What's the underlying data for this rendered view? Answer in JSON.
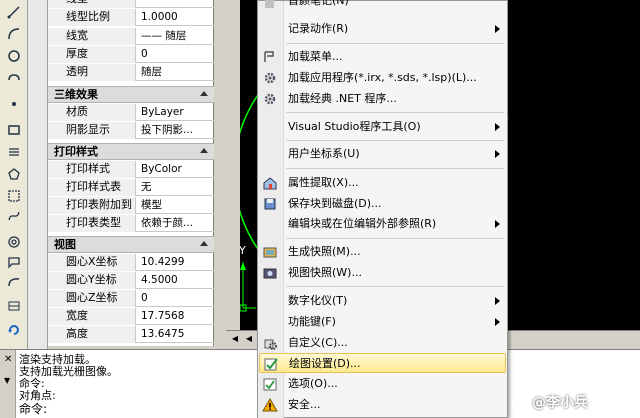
{
  "colors": {
    "canvas": "#000000",
    "circle": "#00ff00",
    "ucs": "#00ff00",
    "menu_highlight": "#fde98c",
    "warning": "#f2a900"
  },
  "properties": {
    "rows_general": [
      {
        "name": "线型",
        "value": ""
      },
      {
        "name": "线型比例",
        "value": "1.0000"
      },
      {
        "name": "线宽",
        "value": "—— 随层"
      },
      {
        "name": "厚度",
        "value": "0"
      },
      {
        "name": "透明",
        "value": "随层"
      }
    ],
    "section_3d": "三维效果",
    "rows_3d": [
      {
        "name": "材质",
        "value": "ByLayer"
      },
      {
        "name": "阴影显示",
        "value": "投下阴影..."
      }
    ],
    "section_plot": "打印样式",
    "rows_plot": [
      {
        "name": "打印样式",
        "value": "ByColor"
      },
      {
        "name": "打印样式表",
        "value": "无"
      },
      {
        "name": "打印表附加到",
        "value": "模型"
      },
      {
        "name": "打印表类型",
        "value": "依赖于颜..."
      }
    ],
    "section_view": "视图",
    "rows_view": [
      {
        "name": "圆心X坐标",
        "value": "10.4299"
      },
      {
        "name": "圆心Y坐标",
        "value": "4.5000"
      },
      {
        "name": "圆心Z坐标",
        "value": "0"
      },
      {
        "name": "宽度",
        "value": "17.7568"
      },
      {
        "name": "高度",
        "value": "13.6475"
      }
    ]
  },
  "canvas": {
    "ucs_y_label": "Y"
  },
  "command_line": [
    "渲染支持加载。",
    "支持加载光栅图像。",
    "命令:",
    "对角点:",
    "命令:"
  ],
  "menu": {
    "top_partial": "首颜笔记(N)",
    "items": [
      {
        "label": "记录动作(R)",
        "icon": "",
        "submenu": true
      },
      {
        "label": "加载菜单...",
        "icon": "load-menu-icon",
        "submenu": false
      },
      {
        "label": "加载应用程序(*.irx, *.sds, *.lsp)(L)...",
        "icon": "load-app-gear-icon",
        "submenu": false
      },
      {
        "label": "加载经典 .NET 程序...",
        "icon": "load-net-gear-icon",
        "submenu": false
      },
      {
        "label": "Visual Studio程序工具(O)",
        "icon": "",
        "submenu": true
      },
      {
        "label": "用户坐标系(U)",
        "icon": "",
        "submenu": true
      },
      {
        "label": "属性提取(X)...",
        "icon": "attribute-extract-icon",
        "submenu": false
      },
      {
        "label": "保存块到磁盘(D)...",
        "icon": "save-block-icon",
        "submenu": false
      },
      {
        "label": "编辑块或在位编辑外部参照(R)",
        "icon": "",
        "submenu": true
      },
      {
        "label": "生成快照(M)...",
        "icon": "snapshot-create-icon",
        "submenu": false
      },
      {
        "label": "视图快照(W)...",
        "icon": "snapshot-view-icon",
        "submenu": false
      },
      {
        "label": "数字化仪(T)",
        "icon": "",
        "submenu": true
      },
      {
        "label": "功能键(F)",
        "icon": "",
        "submenu": true
      },
      {
        "label": "自定义(C)...",
        "icon": "customize-icon",
        "submenu": false
      },
      {
        "label": "绘图设置(D)...",
        "icon": "drafting-settings-icon",
        "submenu": false,
        "highlighted": true
      },
      {
        "label": "选项(O)...",
        "icon": "options-icon",
        "submenu": false
      },
      {
        "label": "安全...",
        "icon": "security-warning-icon",
        "submenu": false
      }
    ]
  },
  "watermark": "@李小兵"
}
